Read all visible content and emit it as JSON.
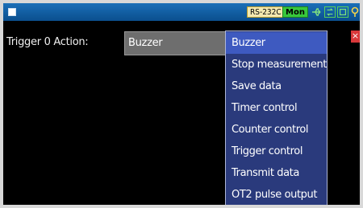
{
  "statusbar": {
    "rs_badge": "RS-232C",
    "mon_badge": "Mon",
    "icons": [
      "window-icon",
      "usb-icon",
      "network-icon",
      "card-icon",
      "key-icon"
    ]
  },
  "form": {
    "label": "Trigger 0 Action:",
    "selected_value": "Buzzer"
  },
  "dropdown": {
    "options": [
      "Buzzer",
      "Stop measurement",
      "Save data",
      "Timer control",
      "Counter control",
      "Trigger control",
      "Transmit data",
      "OT2 pulse output"
    ],
    "selected_index": 0
  },
  "close_symbol": "×"
}
